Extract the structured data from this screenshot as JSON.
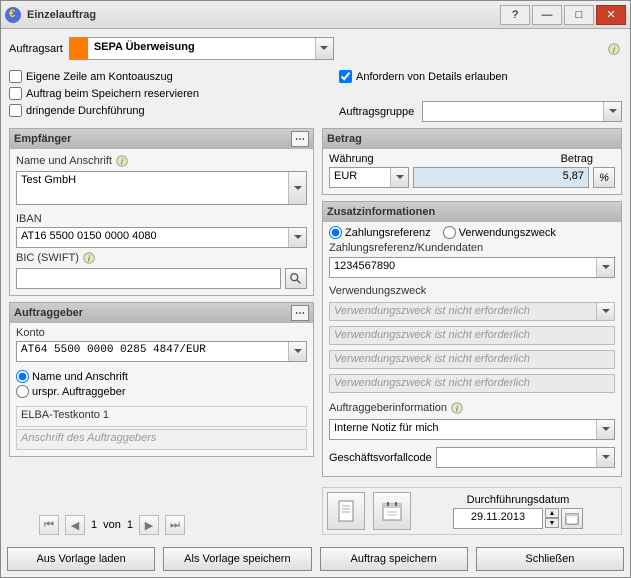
{
  "window": {
    "title": "Einzelauftrag"
  },
  "type": {
    "label": "Auftragsart",
    "value": "SEPA Überweisung"
  },
  "checks": {
    "own_line": "Eigene Zeile am Kontoauszug",
    "reserve": "Auftrag beim Speichern reservieren",
    "urgent": "dringende Durchführung",
    "allow_details": "Anfordern von Details erlauben"
  },
  "group": {
    "label": "Auftragsgruppe",
    "value": ""
  },
  "recipient": {
    "title": "Empfänger",
    "name_label": "Name und Anschrift",
    "name": "Test GmbH",
    "iban_label": "IBAN",
    "iban": "AT16 5500 0150 0000 4080",
    "bic_label": "BIC (SWIFT)",
    "bic": ""
  },
  "originator": {
    "title": "Auftraggeber",
    "konto_label": "Konto",
    "konto": "AT64 5500 0000 0285 4847/EUR",
    "radio_name": "Name und Anschrift",
    "radio_orig": "urspr. Auftraggeber",
    "display_name": "ELBA-Testkonto 1",
    "address_placeholder": "Anschrift des Auftraggebers"
  },
  "amount": {
    "title": "Betrag",
    "currency_label": "Währung",
    "currency": "EUR",
    "amount_label": "Betrag",
    "amount": "5,87"
  },
  "extra": {
    "title": "Zusatzinformationen",
    "radio_ref": "Zahlungsreferenz",
    "radio_purpose": "Verwendungszweck",
    "ref_label": "Zahlungsreferenz/Kundendaten",
    "ref": "1234567890",
    "purpose_label": "Verwendungszweck",
    "purpose_disabled": "Verwendungszweck ist nicht erforderlich",
    "originfo_label": "Auftraggeberinformation",
    "originfo": "Interne Notiz für mich",
    "gvc_label": "Geschäftsvorfallcode",
    "gvc": ""
  },
  "pager": {
    "page": "1",
    "of_label": "von",
    "total": "1"
  },
  "date": {
    "label": "Durchführungsdatum",
    "value": "29.11.2013"
  },
  "buttons": {
    "load": "Aus Vorlage laden",
    "save_tpl": "Als Vorlage speichern",
    "save": "Auftrag speichern",
    "close": "Schließen"
  }
}
